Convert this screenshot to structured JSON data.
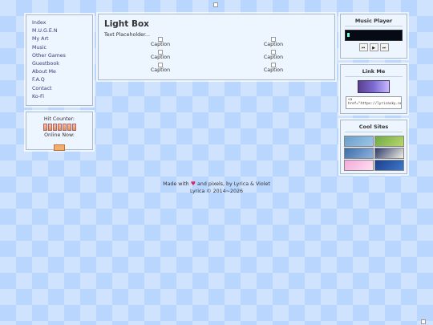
{
  "nav": {
    "items": [
      "Index",
      "M.U.G.E.N",
      "My Art",
      "Music",
      "Other Games",
      "Guestbook",
      "About Me",
      "F.A.Q",
      "Contact",
      "Ko-Fi"
    ]
  },
  "counter": {
    "hit_label": "Hit Counter:",
    "online_label": "Online Now:"
  },
  "main": {
    "title": "Light Box",
    "text": "Text Placeholder...",
    "captions": [
      "Caption",
      "Caption",
      "Caption",
      "Caption",
      "Caption",
      "Caption"
    ]
  },
  "music": {
    "title": "Music Player"
  },
  "linkme": {
    "title": "Link Me",
    "code": "<a href=\"https://lyricasky.neocities.org/\">"
  },
  "cool": {
    "title": "Cool Sites",
    "sites": [
      {
        "color": "#6c9ec8"
      },
      {
        "color": "#6fa84a"
      },
      {
        "color": "#3c6ca8"
      },
      {
        "color": "#2f3b6a"
      },
      {
        "color": "#f4a9d8"
      },
      {
        "color": "#3d79c9"
      }
    ]
  },
  "footer": {
    "made_prefix": "Made with",
    "made_suffix": "and pixels, by Lyrica & Violet",
    "copyright": "Lyrica © 2014~2026"
  },
  "colors": {
    "background": "#cfe3ff",
    "panel": "#edf5ff",
    "link": "#3b3b7a",
    "heart": "#e0245e"
  }
}
